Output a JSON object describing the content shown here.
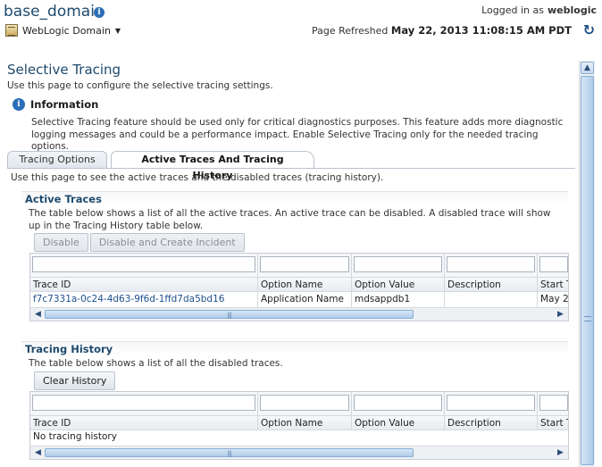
{
  "header": {
    "domain_title": "base_domain",
    "logged_in_label": "Logged in as",
    "user": "weblogic",
    "menu_label": "WebLogic Domain",
    "refreshed_label": "Page Refreshed",
    "refreshed_time": "May 22, 2013 11:08:15 AM PDT"
  },
  "page": {
    "title": "Selective Tracing",
    "description": "Use this page to configure the selective tracing settings."
  },
  "info": {
    "heading": "Information",
    "text": "Selective Tracing feature should be used only for critical diagnostics purposes. This feature adds more diagnostic logging messages and could be a performance impact. Enable Selective Tracing only for the needed tracing options."
  },
  "tabs": [
    {
      "label": "Tracing Options",
      "selected": false
    },
    {
      "label": "Active Traces And Tracing History",
      "selected": true
    }
  ],
  "tab_description": "Use this page to see the active traces and the disabled traces (tracing history).",
  "active_traces": {
    "title": "Active Traces",
    "description": "The table below shows a list of all the active traces. An active trace can be disabled. A disabled trace will show up in the Tracing History table below.",
    "buttons": {
      "disable": "Disable",
      "disable_incident": "Disable and Create Incident"
    },
    "columns": [
      "Trace ID",
      "Option Name",
      "Option Value",
      "Description",
      "Start T"
    ],
    "rows": [
      {
        "trace_id": "f7c7331a-0c24-4d63-9f6d-1ffd7da5bd16",
        "option_name": "Application Name",
        "option_value": "mdsappdb1",
        "description": "",
        "start": "May 2"
      }
    ]
  },
  "tracing_history": {
    "title": "Tracing History",
    "description": "The table below shows a list of all the disabled traces.",
    "buttons": {
      "clear": "Clear History"
    },
    "columns": [
      "Trace ID",
      "Option Name",
      "Option Value",
      "Description",
      "Start T"
    ],
    "empty_text": "No tracing history"
  },
  "colors": {
    "title": "#1e4a6d",
    "link": "#1d4f8c",
    "accent": "#2a6fb8"
  }
}
